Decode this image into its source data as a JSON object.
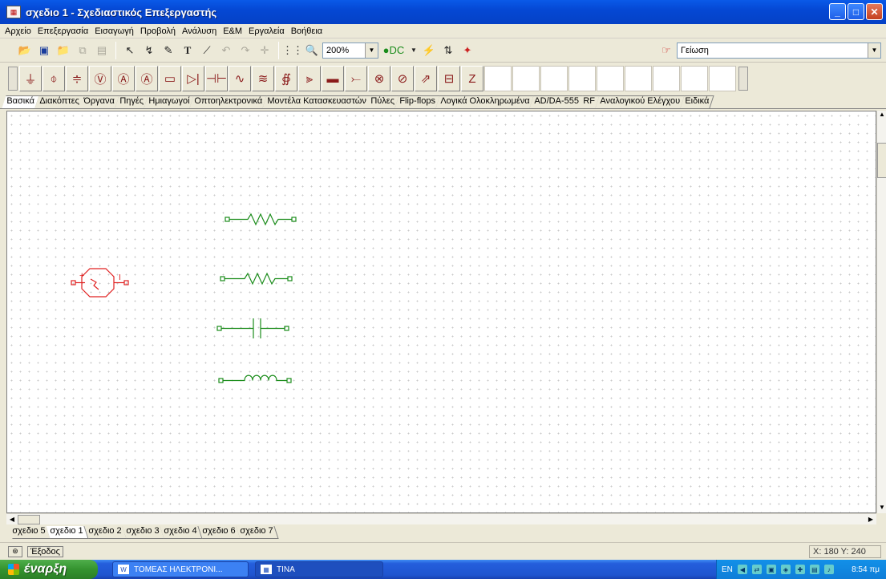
{
  "window": {
    "title": "σχεδιο 1 - Σχεδιαστικός Επεξεργαστής",
    "minimize": "_",
    "maximize": "□",
    "close": "✕"
  },
  "menu": [
    "Αρχείο",
    "Επεξεργασία",
    "Εισαγωγή",
    "Προβολή",
    "Ανάλυση",
    "Ε&Μ",
    "Εργαλεία",
    "Βοήθεια"
  ],
  "toolbar": {
    "zoom_value": "200%",
    "component_select": "Γείωση"
  },
  "palette_tabs": [
    "Βασικά",
    "Διακόπτες",
    "Όργανα",
    "Πηγές",
    "Ημιαγωγοί",
    "Οπτοηλεκτρονικά",
    "Μοντέλα Κατασκευαστών",
    "Πύλες",
    "Flip-flops",
    "Λογικά Ολοκληρωμένα",
    "AD/DA-555",
    "RF",
    "Αναλογικού Ελέγχου",
    "Ειδικά"
  ],
  "palette_active": "Βασικά",
  "schematic": {
    "colors": {
      "wire": "#1a8c1a",
      "source": "#e02020",
      "grid": "#c9c9c9"
    },
    "components": [
      {
        "type": "resistor",
        "name": "resistor-1"
      },
      {
        "type": "resistor",
        "name": "resistor-2"
      },
      {
        "type": "capacitor",
        "name": "capacitor"
      },
      {
        "type": "inductor",
        "name": "inductor"
      },
      {
        "type": "ac-source",
        "name": "ac-source",
        "pins": [
          "+",
          "I"
        ]
      }
    ]
  },
  "sheet_tabs": [
    "σχεδιο 5",
    "σχεδιο 1",
    "σχεδιο 2",
    "σχεδιο 3",
    "σχεδιο 4",
    "σχεδιο 6",
    "σχεδιο 7"
  ],
  "sheet_active": "σχεδιο 1",
  "status": {
    "exit_label": "Έξοδος",
    "coords": "X: 180 Y: 240"
  },
  "taskbar": {
    "start_label": "έναρξη",
    "items": [
      "ΤΟΜΕΑΣ ΗΛΕΚΤΡΟΝΙ...",
      "TINA"
    ],
    "lang": "EN",
    "clock": "8:54 πμ"
  }
}
